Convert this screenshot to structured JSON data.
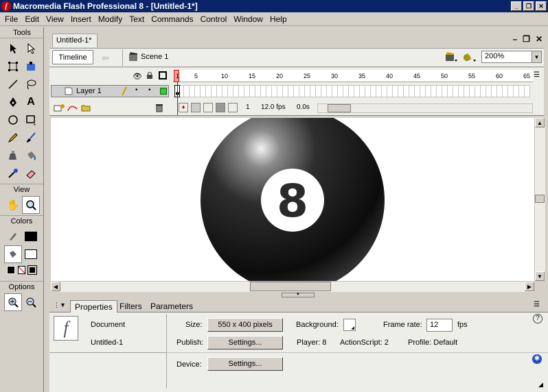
{
  "window": {
    "title": "Macromedia Flash Professional 8 - [Untitled-1*]",
    "min": "_",
    "restore": "❐",
    "close": "✕"
  },
  "menu": [
    "File",
    "Edit",
    "View",
    "Insert",
    "Modify",
    "Text",
    "Commands",
    "Control",
    "Window",
    "Help"
  ],
  "tools": {
    "header": "Tools",
    "view_label": "View",
    "colors_label": "Colors",
    "options_label": "Options"
  },
  "document": {
    "tab": "Untitled-1*",
    "timeline_button": "Timeline",
    "scene": "Scene 1",
    "zoom": "200%"
  },
  "timeline": {
    "layer_name": "Layer 1",
    "ruler": [
      "1",
      "5",
      "10",
      "15",
      "20",
      "25",
      "30",
      "35",
      "40",
      "45",
      "50",
      "55",
      "60",
      "65"
    ],
    "current_frame": "1",
    "fps": "12.0 fps",
    "elapsed": "0.0s"
  },
  "stage": {
    "ball_number": "8"
  },
  "properties": {
    "tabs": [
      "Properties",
      "Filters",
      "Parameters"
    ],
    "doc_type": "Document",
    "doc_name": "Untitled-1",
    "size_label": "Size:",
    "size_value": "550 x 400 pixels",
    "publish_label": "Publish:",
    "settings_label": "Settings...",
    "background_label": "Background:",
    "player": "Player: 8",
    "actionscript": "ActionScript:  2",
    "profile": "Profile:  Default",
    "frame_rate_label": "Frame rate:",
    "frame_rate": "12",
    "fps_unit": "fps",
    "device_label": "Device:",
    "device_settings": "Settings...",
    "help": "?"
  }
}
